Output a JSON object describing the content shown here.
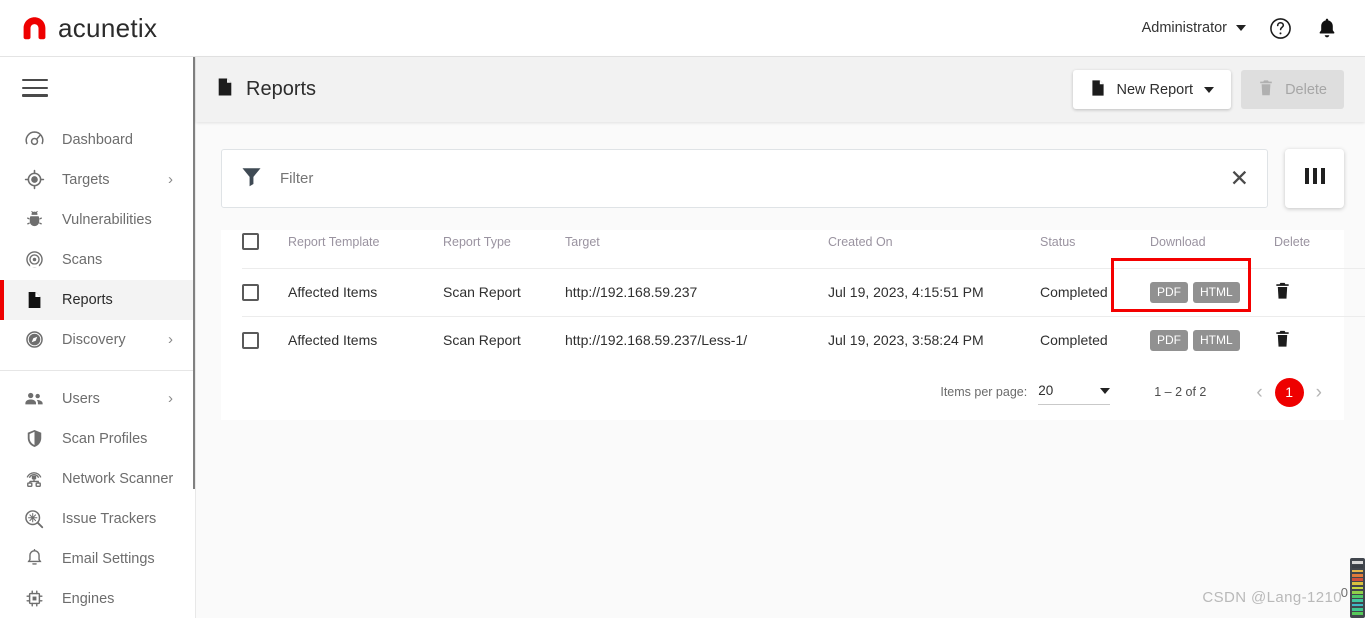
{
  "brand": {
    "name": "acunetix",
    "logo_color": "#ee0000"
  },
  "topbar": {
    "user_label": "Administrator",
    "help_icon": "help-circle-icon",
    "notifications_icon": "bell-icon"
  },
  "sidebar": {
    "menu_icon": "hamburger-icon",
    "items": [
      {
        "label": "Dashboard",
        "icon": "gauge-icon",
        "chevron": "",
        "active": false
      },
      {
        "label": "Targets",
        "icon": "target-icon",
        "chevron": "›",
        "active": false
      },
      {
        "label": "Vulnerabilities",
        "icon": "bug-icon",
        "chevron": "",
        "active": false
      },
      {
        "label": "Scans",
        "icon": "radar-icon",
        "chevron": "",
        "active": false
      },
      {
        "label": "Reports",
        "icon": "document-icon",
        "chevron": "",
        "active": true
      },
      {
        "label": "Discovery",
        "icon": "compass-icon",
        "chevron": "›",
        "active": false
      }
    ],
    "items2": [
      {
        "label": "Users",
        "icon": "users-icon",
        "chevron": "›"
      },
      {
        "label": "Scan Profiles",
        "icon": "shield-icon",
        "chevron": ""
      },
      {
        "label": "Network Scanner",
        "icon": "network-scanner-icon",
        "chevron": ""
      },
      {
        "label": "Issue Trackers",
        "icon": "issue-tracker-icon",
        "chevron": ""
      },
      {
        "label": "Email Settings",
        "icon": "bell-outline-icon",
        "chevron": ""
      },
      {
        "label": "Engines",
        "icon": "chip-icon",
        "chevron": ""
      }
    ]
  },
  "page": {
    "title": "Reports",
    "title_icon": "document-icon",
    "new_report_label": "New Report",
    "new_report_icon": "document-icon",
    "delete_label": "Delete",
    "delete_icon": "trash-icon"
  },
  "filter": {
    "icon": "funnel-icon",
    "placeholder": "Filter",
    "value": "",
    "clear_icon": "close-icon",
    "columns_icon": "columns-icon"
  },
  "table": {
    "columns": [
      "Report Template",
      "Report Type",
      "Target",
      "Created On",
      "Status",
      "Download",
      "Delete"
    ],
    "rows": [
      {
        "selected": false,
        "template": "Affected Items",
        "type": "Scan Report",
        "target": "http://192.168.59.237",
        "created_on": "Jul 19, 2023, 4:15:51 PM",
        "status": "Completed",
        "downloads": [
          "PDF",
          "HTML"
        ],
        "highlighted": true
      },
      {
        "selected": false,
        "template": "Affected Items",
        "type": "Scan Report",
        "target": "http://192.168.59.237/Less-1/",
        "created_on": "Jul 19, 2023, 3:58:24 PM",
        "status": "Completed",
        "downloads": [
          "PDF",
          "HTML"
        ],
        "highlighted": false
      }
    ],
    "highlight_color": "#f40000"
  },
  "paginator": {
    "items_per_page_label": "Items per page:",
    "items_per_page_value": "20",
    "range_label": "1 – 2 of 2",
    "prev_icon": "chevron-left-icon",
    "next_icon": "chevron-right-icon",
    "current_page": "1",
    "page_color": "#ee0000"
  },
  "watermark": {
    "text": "CSDN @Lang-1210",
    "zero": "0"
  }
}
